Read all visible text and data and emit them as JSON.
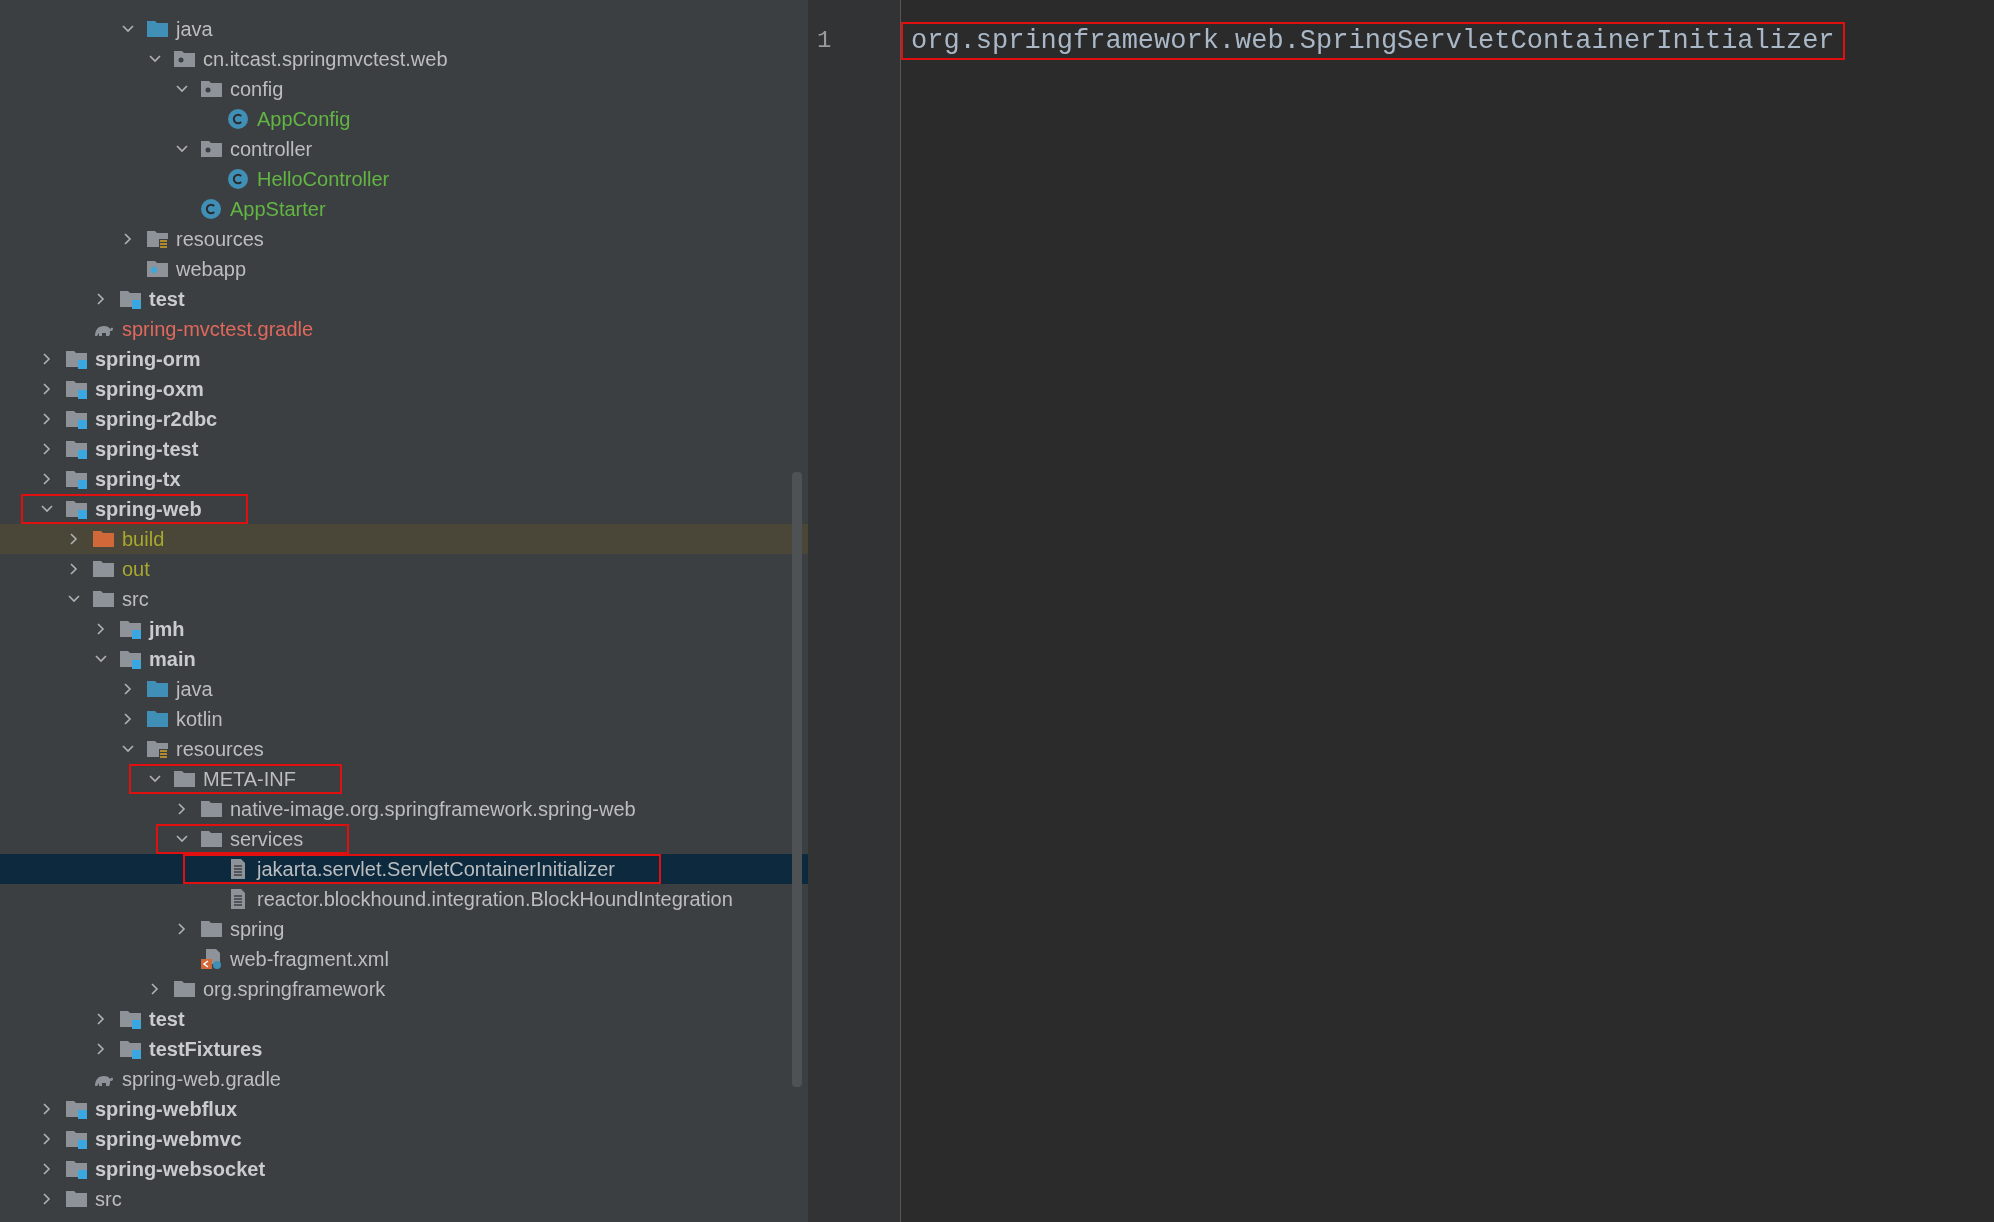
{
  "project_tree": {
    "items": [
      {
        "children": [
          {
            "children": [
              {
                "children": [
                  {
                    "label": "java",
                    "kind": "source",
                    "expanded": true,
                    "selected": false,
                    "highlighted": false,
                    "marked": false,
                    "children": [
                      {
                        "label": "cn.itcast.springmvctest.web",
                        "kind": "package",
                        "expanded": true,
                        "selected": false,
                        "highlighted": false,
                        "marked": false,
                        "children": [
                          {
                            "label": "config",
                            "kind": "package",
                            "expanded": true,
                            "selected": false,
                            "highlighted": false,
                            "marked": false,
                            "children": [
                              {
                                "label": "AppConfig",
                                "kind": "class",
                                "color": "#62b543",
                                "selected": false,
                                "highlighted": false,
                                "marked": false
                              }
                            ]
                          },
                          {
                            "label": "controller",
                            "kind": "package",
                            "expanded": true,
                            "selected": false,
                            "highlighted": false,
                            "marked": false,
                            "children": [
                              {
                                "label": "HelloController",
                                "kind": "class",
                                "color": "#62b543",
                                "selected": false,
                                "highlighted": false,
                                "marked": false
                              }
                            ]
                          },
                          {
                            "label": "AppStarter",
                            "kind": "class",
                            "color": "#62b543",
                            "selected": false,
                            "highlighted": false,
                            "marked": false
                          }
                        ]
                      }
                    ]
                  },
                  {
                    "label": "resources",
                    "kind": "resources",
                    "expanded": false,
                    "selected": false,
                    "highlighted": false,
                    "marked": false
                  },
                  {
                    "label": "webapp",
                    "kind": "webapp",
                    "selected": false,
                    "highlighted": false,
                    "marked": false
                  }
                ]
              },
              {
                "label": "test",
                "kind": "module",
                "expanded": false,
                "selected": false,
                "highlighted": false,
                "marked": false
              }
            ]
          },
          {
            "label": "spring-mvctest.gradle",
            "kind": "gradle",
            "color": "#e0685c",
            "selected": false,
            "highlighted": false,
            "marked": false
          }
        ]
      },
      {
        "label": "spring-orm",
        "kind": "module",
        "expanded": false,
        "selected": false,
        "highlighted": false,
        "marked": false
      },
      {
        "label": "spring-oxm",
        "kind": "module",
        "expanded": false,
        "selected": false,
        "highlighted": false,
        "marked": false
      },
      {
        "label": "spring-r2dbc",
        "kind": "module",
        "expanded": false,
        "selected": false,
        "highlighted": false,
        "marked": false
      },
      {
        "label": "spring-test",
        "kind": "module",
        "expanded": false,
        "selected": false,
        "highlighted": false,
        "marked": false
      },
      {
        "label": "spring-tx",
        "kind": "module",
        "expanded": false,
        "selected": false,
        "highlighted": false,
        "marked": false
      },
      {
        "label": "spring-web",
        "kind": "module",
        "expanded": true,
        "selected": false,
        "highlighted": false,
        "marked": true,
        "children": [
          {
            "label": "build",
            "kind": "excluded",
            "color": "#a8a82e",
            "expanded": false,
            "selected": false,
            "highlighted": true,
            "marked": false
          },
          {
            "label": "out",
            "kind": "folder",
            "color": "#a8a82e",
            "expanded": false,
            "selected": false,
            "highlighted": false,
            "marked": false
          },
          {
            "label": "src",
            "kind": "folder",
            "expanded": true,
            "selected": false,
            "highlighted": false,
            "marked": false,
            "children": [
              {
                "label": "jmh",
                "kind": "module",
                "expanded": false,
                "selected": false,
                "highlighted": false,
                "marked": false
              },
              {
                "label": "main",
                "kind": "module",
                "expanded": true,
                "selected": false,
                "highlighted": false,
                "marked": false,
                "children": [
                  {
                    "label": "java",
                    "kind": "source",
                    "expanded": false,
                    "selected": false,
                    "highlighted": false,
                    "marked": false
                  },
                  {
                    "label": "kotlin",
                    "kind": "source",
                    "expanded": false,
                    "selected": false,
                    "highlighted": false,
                    "marked": false
                  },
                  {
                    "label": "resources",
                    "kind": "resources",
                    "expanded": true,
                    "selected": false,
                    "highlighted": false,
                    "marked": false,
                    "children": [
                      {
                        "label": "META-INF",
                        "kind": "folder",
                        "expanded": true,
                        "selected": false,
                        "highlighted": false,
                        "marked": true,
                        "children": [
                          {
                            "label": "native-image.org.springframework.spring-web",
                            "kind": "folder",
                            "expanded": false,
                            "selected": false,
                            "highlighted": false,
                            "marked": false
                          },
                          {
                            "label": "services",
                            "kind": "folder",
                            "expanded": true,
                            "selected": false,
                            "highlighted": false,
                            "marked": true,
                            "children": [
                              {
                                "label": "jakarta.servlet.ServletContainerInitializer",
                                "kind": "file",
                                "selected": true,
                                "highlighted": false,
                                "marked": true
                              },
                              {
                                "label": "reactor.blockhound.integration.BlockHoundIntegration",
                                "kind": "file",
                                "selected": false,
                                "highlighted": false,
                                "marked": false
                              }
                            ]
                          },
                          {
                            "label": "spring",
                            "kind": "folder",
                            "expanded": false,
                            "selected": false,
                            "highlighted": false,
                            "marked": false
                          },
                          {
                            "label": "web-fragment.xml",
                            "kind": "xml",
                            "selected": false,
                            "highlighted": false,
                            "marked": false
                          }
                        ]
                      },
                      {
                        "label": "org.springframework",
                        "kind": "folder",
                        "expanded": false,
                        "selected": false,
                        "highlighted": false,
                        "marked": false
                      }
                    ]
                  }
                ]
              },
              {
                "label": "test",
                "kind": "module",
                "expanded": false,
                "selected": false,
                "highlighted": false,
                "marked": false
              },
              {
                "label": "testFixtures",
                "kind": "module",
                "expanded": false,
                "selected": false,
                "highlighted": false,
                "marked": false
              }
            ]
          },
          {
            "label": "spring-web.gradle",
            "kind": "gradle",
            "selected": false,
            "highlighted": false,
            "marked": false
          }
        ]
      },
      {
        "label": "spring-webflux",
        "kind": "module",
        "expanded": false,
        "selected": false,
        "highlighted": false,
        "marked": false
      },
      {
        "label": "spring-webmvc",
        "kind": "module",
        "expanded": false,
        "selected": false,
        "highlighted": false,
        "marked": false
      },
      {
        "label": "spring-websocket",
        "kind": "module",
        "expanded": false,
        "selected": false,
        "highlighted": false,
        "marked": false
      },
      {
        "label": "src",
        "kind": "folder",
        "expanded": false,
        "selected": false,
        "highlighted": false,
        "marked": false
      }
    ]
  },
  "editor": {
    "lines": [
      {
        "number": "1",
        "text": "org.springframework.web.SpringServletContainerInitializer",
        "marked": true
      }
    ]
  }
}
